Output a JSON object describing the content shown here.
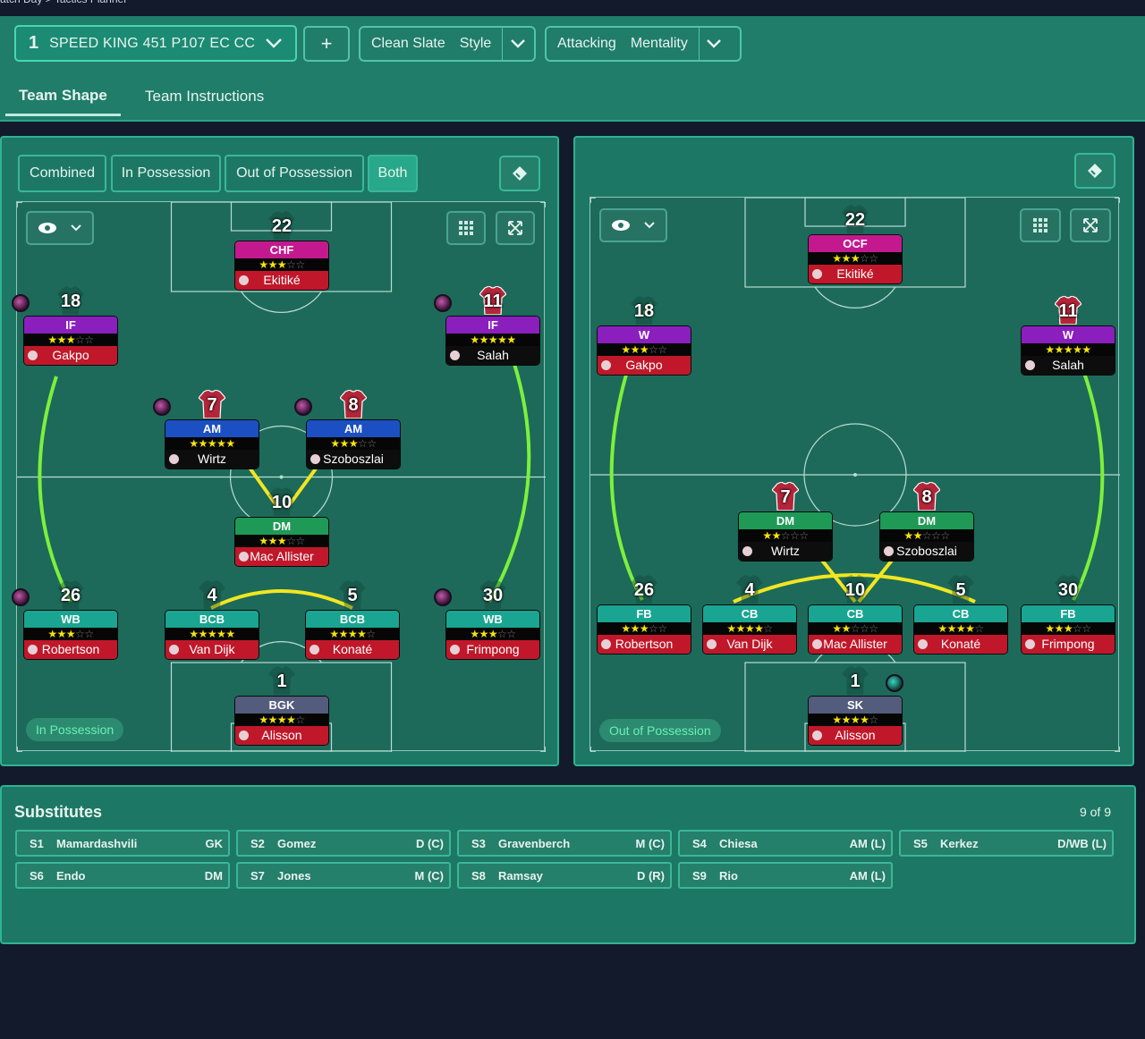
{
  "breadcrumb": "atch Day  >  Tactics Planner",
  "tactic": {
    "number": "1",
    "name": "SPEED KING 451 P107  EC CC"
  },
  "style": {
    "value": "Clean Slate",
    "label": "Style"
  },
  "mentality": {
    "value": "Attacking",
    "label": "Mentality"
  },
  "add_label": "+",
  "tabs": [
    "Team Shape",
    "Team Instructions"
  ],
  "left_panel": {
    "toggles": [
      "Combined",
      "In Possession",
      "Out of Possession",
      "Both"
    ],
    "active_toggle": "Both",
    "status": "In Possession",
    "players": [
      {
        "num": "22",
        "role": "CHF",
        "rating": 3,
        "name": "Ekitiké",
        "role_color": "#c4198e"
      },
      {
        "num": "18",
        "role": "IF",
        "rating": 3,
        "name": "Gakpo",
        "role_color": "#8b1fbe"
      },
      {
        "num": "11",
        "role": "IF",
        "rating": 4.5,
        "name": "Salah",
        "role_color": "#8b1fbe"
      },
      {
        "num": "7",
        "role": "AM",
        "rating": 4.5,
        "name": "Wirtz",
        "role_color": "#1c4fc2"
      },
      {
        "num": "8",
        "role": "AM",
        "rating": 3,
        "name": "Szoboszlai",
        "role_color": "#1c4fc2"
      },
      {
        "num": "10",
        "role": "DM",
        "rating": 3,
        "name": "Mac Allister",
        "role_color": "#1e9a56"
      },
      {
        "num": "26",
        "role": "WB",
        "rating": 3,
        "name": "Robertson",
        "role_color": "#19a591"
      },
      {
        "num": "4",
        "role": "BCB",
        "rating": 4.5,
        "name": "Van Dijk",
        "role_color": "#19a591"
      },
      {
        "num": "5",
        "role": "BCB",
        "rating": 3.5,
        "name": "Konaté",
        "role_color": "#19a591"
      },
      {
        "num": "30",
        "role": "WB",
        "rating": 2.5,
        "name": "Frimpong",
        "role_color": "#19a591"
      },
      {
        "num": "1",
        "role": "BGK",
        "rating": 4,
        "name": "Alisson",
        "role_color": "#535c7c"
      }
    ]
  },
  "right_panel": {
    "status": "Out of Possession",
    "players": [
      {
        "num": "22",
        "role": "OCF",
        "rating": 3,
        "name": "Ekitiké",
        "role_color": "#c4198e"
      },
      {
        "num": "18",
        "role": "W",
        "rating": 3,
        "name": "Gakpo",
        "role_color": "#8b1fbe"
      },
      {
        "num": "11",
        "role": "W",
        "rating": 4.5,
        "name": "Salah",
        "role_color": "#8b1fbe"
      },
      {
        "num": "7",
        "role": "DM",
        "rating": 1.5,
        "name": "Wirtz",
        "role_color": "#1e9a56"
      },
      {
        "num": "8",
        "role": "DM",
        "rating": 2,
        "name": "Szoboszlai",
        "role_color": "#1e9a56"
      },
      {
        "num": "26",
        "role": "FB",
        "rating": 2.5,
        "name": "Robertson",
        "role_color": "#19a591"
      },
      {
        "num": "4",
        "role": "CB",
        "rating": 4,
        "name": "Van Dijk",
        "role_color": "#19a591"
      },
      {
        "num": "10",
        "role": "CB",
        "rating": 1.5,
        "name": "Mac Allister",
        "role_color": "#19a591"
      },
      {
        "num": "5",
        "role": "CB",
        "rating": 3.5,
        "name": "Konaté",
        "role_color": "#19a591"
      },
      {
        "num": "30",
        "role": "FB",
        "rating": 2.5,
        "name": "Frimpong",
        "role_color": "#19a591"
      },
      {
        "num": "1",
        "role": "SK",
        "rating": 4,
        "name": "Alisson",
        "role_color": "#535c7c"
      }
    ]
  },
  "substitutes": {
    "title": "Substitutes",
    "count": "9 of 9",
    "items": [
      {
        "id": "S1",
        "name": "Mamardashvili",
        "pos": "GK"
      },
      {
        "id": "S2",
        "name": "Gomez",
        "pos": "D (C)"
      },
      {
        "id": "S3",
        "name": "Gravenberch",
        "pos": "M (C)"
      },
      {
        "id": "S4",
        "name": "Chiesa",
        "pos": "AM (L)"
      },
      {
        "id": "S5",
        "name": "Kerkez",
        "pos": "D/WB (L)"
      },
      {
        "id": "S6",
        "name": "Endo",
        "pos": "DM"
      },
      {
        "id": "S7",
        "name": "Jones",
        "pos": "M (C)"
      },
      {
        "id": "S8",
        "name": "Ramsay",
        "pos": "D (R)"
      },
      {
        "id": "S9",
        "name": "Rio",
        "pos": "AM (L)"
      }
    ]
  },
  "colors": {
    "accent": "#2fb393",
    "panel": "#1c7864",
    "pitch": "#1d6a5a",
    "shirt": "#b3263a",
    "name_bar": "#c0182a"
  }
}
